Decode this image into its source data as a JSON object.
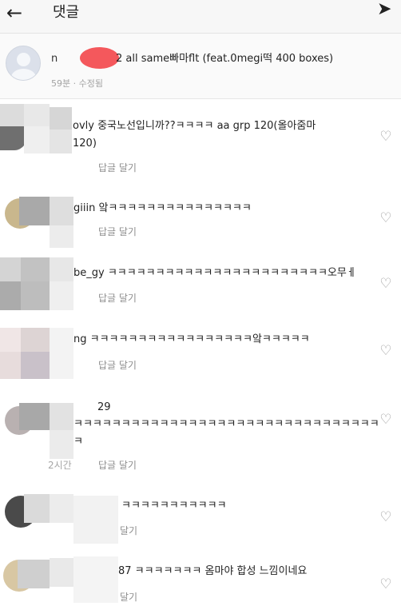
{
  "header": {
    "back_icon": "←",
    "title": "댓글",
    "send_icon": "➤"
  },
  "caption": {
    "username_prefix": "n",
    "text": "2 all same빠마flt (feat.0megi떡 400 boxes)",
    "meta": "59분 · 수정됨"
  },
  "reply_label": "답글 달기",
  "heart_icon": "♡",
  "comments": [
    {
      "line1": "ovly 중국노선입니까??ㅋㅋㅋㅋ aa grp 120(올아줌마",
      "line2": "120)",
      "reply": "답글 달기"
    },
    {
      "line1": "giiin 앜ㅋㅋㅋㅋㅋㅋㅋㅋㅋㅋㅋㅋㅋㅋㅋ",
      "reply": "답글 달기"
    },
    {
      "line1": "be_gy ㅋㅋㅋㅋㅋㅋㅋㅋㅋㅋㅋㅋㅋㅋㅋㅋㅋㅋㅋㅋㅋㅋㅋ오무ㅔ",
      "reply": "답글 달기"
    },
    {
      "line1": "ng ㅋㅋㅋㅋㅋㅋㅋㅋㅋㅋㅋㅋㅋㅋㅋㅋㅋ앜ㅋㅋㅋㅋㅋ",
      "reply": "답글 달기"
    },
    {
      "line1": "29",
      "line2": "ㅋㅋㅋㅋㅋㅋㅋㅋㅋㅋㅋㅋㅋㅋㅋㅋㅋㅋㅋㅋㅋㅋㅋㅋㅋㅋㅋㅋㅋㅋㅋㅋ",
      "line3": "ㅋ",
      "time": "2시간",
      "reply": "답글 달기"
    },
    {
      "line1": "ㅋㅋㅋㅋㅋㅋㅋㅋㅋㅋㅋ",
      "reply": "달기"
    },
    {
      "line1": "87 ㅋㅋㅋㅋㅋㅋㅋ 옴마야 합성 느낌이네요",
      "reply": "달기"
    }
  ]
}
